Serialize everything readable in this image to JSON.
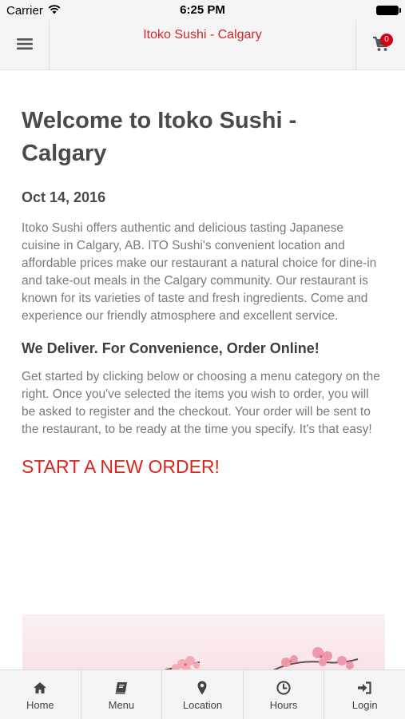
{
  "status_bar": {
    "carrier": "Carrier",
    "time": "6:25 PM"
  },
  "header": {
    "title": "Itoko Sushi - Calgary",
    "cart_count": "0",
    "menu_icon": "hamburger-icon",
    "cart_icon": "shopping-cart-icon"
  },
  "main": {
    "title": "Welcome to Itoko Sushi - Calgary",
    "date": "Oct 14, 2016",
    "intro": "Itoko Sushi offers authentic and delicious tasting Japanese cuisine in Calgary, AB. ITO Sushi's convenient location and affordable prices make our restaurant a natural choice for dine-in and take-out meals in the Calgary community. Our restaurant is known for its varieties of taste and fresh ingredients. Come and experience our friendly atmosphere and excellent service.",
    "deliver_heading": "We Deliver. For Convenience, Order Online!",
    "instructions": "Get started by clicking below or choosing a menu category on the right. Once you've selected the items you wish to order, you will be asked to register and the checkout. Your order will be sent to the restaurant, to be ready at the time you specify. It's that easy!",
    "order_link": "START A NEW ORDER!"
  },
  "tabs": [
    {
      "label": "Home",
      "icon": "home-icon"
    },
    {
      "label": "Menu",
      "icon": "book-icon"
    },
    {
      "label": "Location",
      "icon": "map-marker-icon"
    },
    {
      "label": "Hours",
      "icon": "clock-icon"
    },
    {
      "label": "Login",
      "icon": "sign-in-icon"
    }
  ],
  "colors": {
    "accent": "#d9251d",
    "header_bg": "#f4f4f4",
    "badge": "#d0021b"
  }
}
